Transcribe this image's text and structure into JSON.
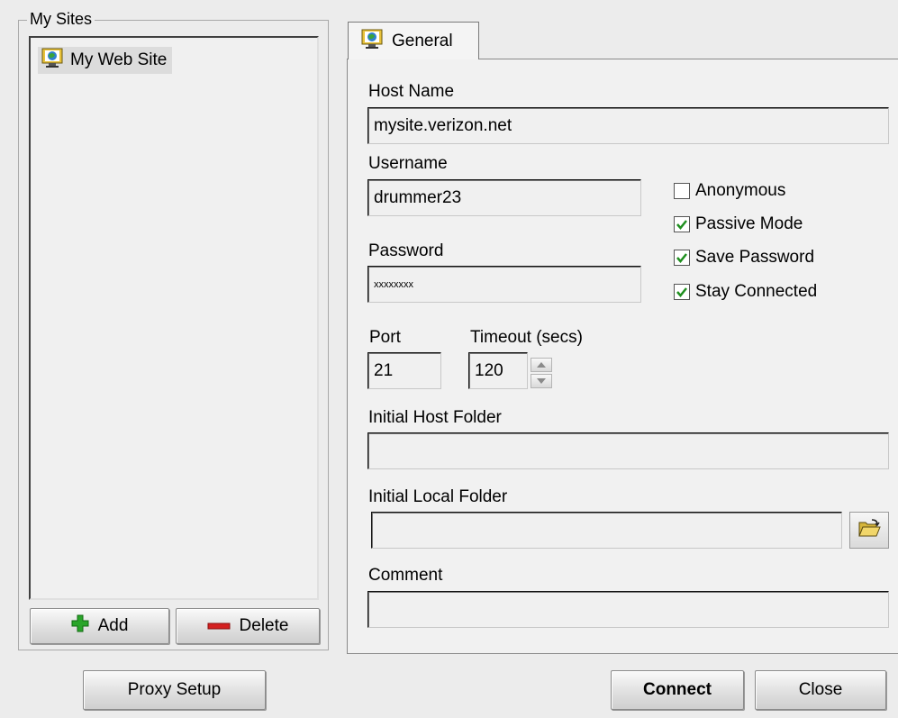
{
  "sites": {
    "group_title": "My Sites",
    "items": [
      {
        "label": "My Web Site"
      }
    ],
    "add_label": "Add",
    "delete_label": "Delete"
  },
  "tab": {
    "label": "General"
  },
  "form": {
    "host_name_label": "Host Name",
    "host_name_value": "mysite.verizon.net",
    "username_label": "Username",
    "username_value": "drummer23",
    "password_label": "Password",
    "password_value": "xxxxxxxx",
    "port_label": "Port",
    "port_value": "21",
    "timeout_label": "Timeout (secs)",
    "timeout_value": "120",
    "initial_host_folder_label": "Initial Host Folder",
    "initial_host_folder_value": "",
    "initial_local_folder_label": "Initial Local Folder",
    "initial_local_folder_value": "",
    "comment_label": "Comment",
    "comment_value": ""
  },
  "options": [
    {
      "label": "Anonymous",
      "checked": false
    },
    {
      "label": "Passive Mode",
      "checked": true
    },
    {
      "label": "Save Password",
      "checked": true
    },
    {
      "label": "Stay Connected",
      "checked": true
    }
  ],
  "footer": {
    "proxy_label": "Proxy Setup",
    "connect_label": "Connect",
    "close_label": "Close"
  },
  "colors": {
    "check": "#1f8f1f",
    "add": "#2aa52a",
    "delete": "#d42020"
  }
}
